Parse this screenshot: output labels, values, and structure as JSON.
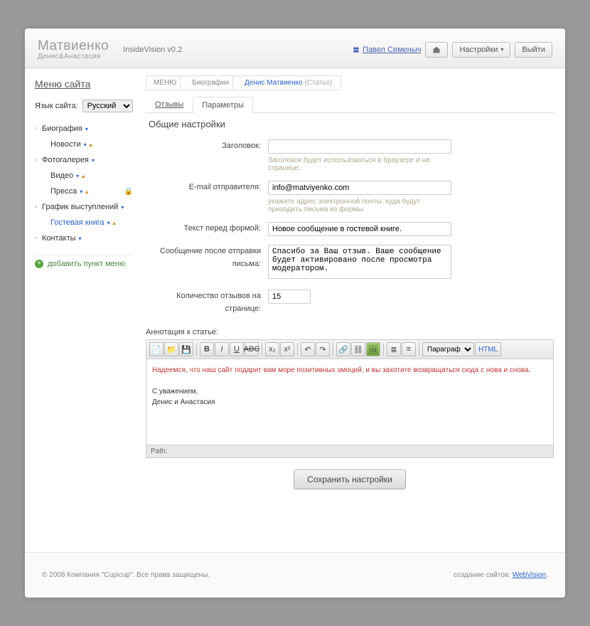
{
  "header": {
    "logo_line1": "Матвиенко",
    "logo_line2": "Денис&Анастасия",
    "app_title": "InsideVision v0.2",
    "user_name": "Павел Семеныч",
    "settings_btn": "Настройки",
    "logout_btn": "Выйти"
  },
  "sidebar": {
    "title": "Меню сайта",
    "lang_label": "Язык сайта:",
    "lang_value": "Русский",
    "items": [
      {
        "label": "Биография",
        "kind": "parent"
      },
      {
        "label": "Новости",
        "kind": "child"
      },
      {
        "label": "Фотогалерея",
        "kind": "parent"
      },
      {
        "label": "Видео",
        "kind": "child"
      },
      {
        "label": "Пресса",
        "kind": "child",
        "locked": true
      },
      {
        "label": "График выступлений",
        "kind": "parent"
      },
      {
        "label": "Гостевая книга",
        "kind": "child",
        "active": true
      },
      {
        "label": "Контакты",
        "kind": "parent_plain"
      }
    ],
    "add_item": "добавить пункт меню"
  },
  "breadcrumbs": [
    {
      "label": "МЕНЮ"
    },
    {
      "label": "Биография"
    },
    {
      "label": "Денис Матвиенко",
      "sub": "(Статья)",
      "active": true
    }
  ],
  "tabs": {
    "reviews": "Отзывы",
    "params": "Параметры"
  },
  "section_title": "Общие настройки",
  "form": {
    "title_label": "Заголовок:",
    "title_value": "",
    "title_help": "Заголовок будет использоваться в браузере и на странице.",
    "email_label": "E-mail отправителя:",
    "email_value": "info@matviyenko.com",
    "email_help": "укажите адрес электронной почты, куда будут приходить письма из формы.",
    "pretext_label": "Текст перед формой:",
    "pretext_value": "Новое сообщение в гостевой книге.",
    "aftermsg_label": "Сообщение после отправки письма:",
    "aftermsg_value": "Спасибо за Ваш отзыв. Ваше сообщение будет активировано после просмотра модератором.",
    "count_label": "Количество отзывов на странице:",
    "count_value": "15"
  },
  "annotation": {
    "title": "Аннотация к статье:",
    "format_selected": "Параграф",
    "html_label": "HTML",
    "body_line1": "Надеемся, что наш сайт подарит вам море позитивных эмоций, и вы захотите возвращаться сюда с нова и снова.",
    "body_line2": "С уважением,",
    "body_line3": "Денис и Анастасия",
    "path_label": "Path:"
  },
  "save_btn": "Сохранить настройки",
  "footer": {
    "copyright": "© 2008 Компания \"Cupicup\". Все права защищены.",
    "credit_text": "создание сайтов: ",
    "credit_link": "WebVision"
  }
}
